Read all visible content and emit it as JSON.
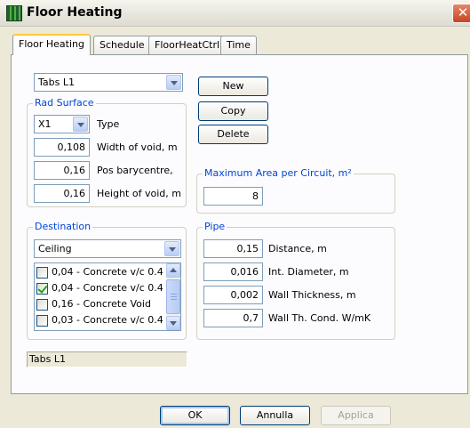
{
  "window": {
    "title": "Floor Heating",
    "close_glyph": "✕"
  },
  "tabs": [
    {
      "label": "Floor Heating"
    },
    {
      "label": "Schedule"
    },
    {
      "label": "FloorHeatCtrl"
    },
    {
      "label": "Time"
    }
  ],
  "main": {
    "selector_value": "Tabs L1",
    "buttons": {
      "new": "New",
      "copy": "Copy",
      "delete": "Delete"
    },
    "rad_surface": {
      "legend": "Rad Surface",
      "type_value": "X1",
      "type_label": "Type",
      "fields": [
        {
          "value": "0,108",
          "label": "Width of void, m"
        },
        {
          "value": "0,16",
          "label": "Pos barycentre,"
        },
        {
          "value": "0,16",
          "label": "Height of void, m"
        }
      ]
    },
    "max_area": {
      "legend": "Maximum Area per Circuit, m²",
      "value": "8"
    },
    "destination": {
      "legend": "Destination",
      "selected": "Ceiling",
      "items": [
        {
          "text": "0,04 - Concrete v/c 0.4",
          "checked": false
        },
        {
          "text": "0,04 - Concrete v/c 0.4",
          "checked": true
        },
        {
          "text": "0,16 - Concrete Void",
          "checked": false
        },
        {
          "text": "0,03 - Concrete v/c 0.4",
          "checked": false
        }
      ]
    },
    "pipe": {
      "legend": "Pipe",
      "fields": [
        {
          "value": "0,15",
          "label": "Distance, m"
        },
        {
          "value": "0,016",
          "label": "Int. Diameter, m"
        },
        {
          "value": "0,002",
          "label": "Wall Thickness, m"
        },
        {
          "value": "0,7",
          "label": "Wall Th. Cond. W/mK"
        }
      ]
    },
    "status_text": "Tabs L1"
  },
  "footer": {
    "ok": "OK",
    "cancel": "Annulla",
    "apply": "Applica"
  },
  "colors": {
    "legend": "#0046d5",
    "active_tab_highlight": "#ffc83c",
    "close_button": "#c9441f"
  }
}
